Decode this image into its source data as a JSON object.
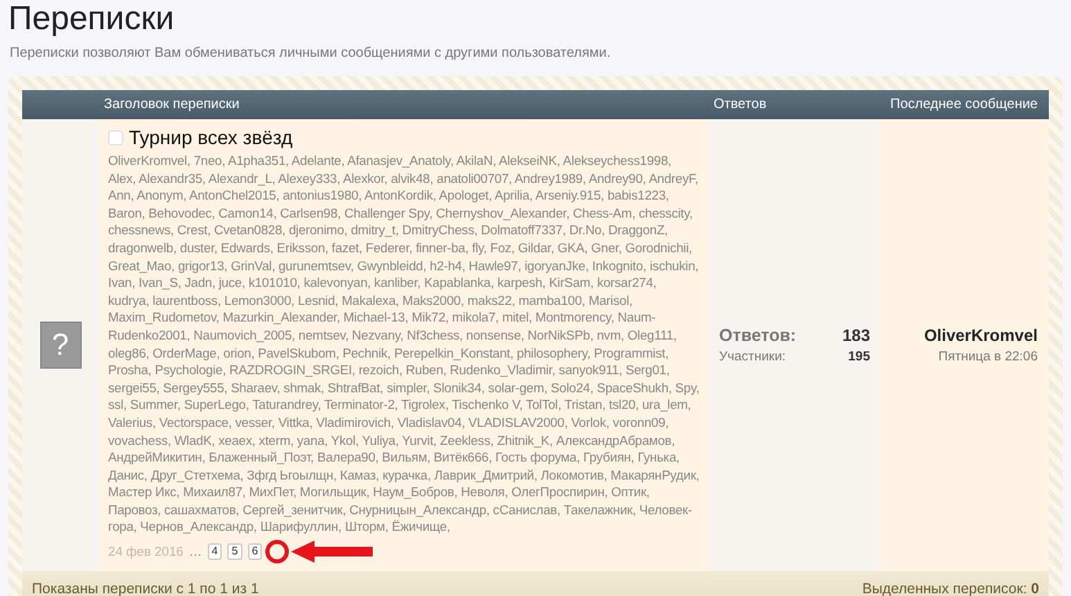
{
  "page": {
    "title": "Переписки",
    "description": "Переписки позволяют Вам обмениваться личными сообщениями с другими пользователями."
  },
  "table": {
    "columns": [
      "Заголовок переписки",
      "Ответов",
      "Последнее сообщение"
    ],
    "rows": [
      {
        "avatar_symbol": "?",
        "checked": false,
        "title": "Турнир всех звёзд",
        "participants": "OliverKromvel, 7neo, A1pha351, Adelante, Afanasjev_Anatoly, AkilaN, AlekseiNK, Alekseychess1998, Alex, Alexandr35, Alexandr_L, Alexey333, Alexkor, alvik48, anatoli00707, Andrey1989, Andrey90, AndreyF, Ann, Anonym, AntonChel2015, antonius1980, AntonKordik, Apologet, Aprilia, Arseniy.915, babis1223, Baron, Behovodec, Camon14, Carlsen98, Challenger Spy, Chernyshov_Alexander, Chess-Am, chesscity, chessnews, Crest, Cvetan0828, djeronimo, dmitry_t, DmitryChess, Dolmatoff7337, Dr.No, DraggonZ, dragonwelb, duster, Edwards, Eriksson, fazet, Federer, finner-ba, fly, Foz, Gildar, GKA, Gner, Gorodnichii, Great_Mao, grigor13, GrinVal, gurunemtsev, Gwynbleidd, h2-h4, Hawle97, igoryanJke, Inkognito, ischukin, Ivan, Ivan_S, Jadn, juce, k101010, kalevonyan, kanliber, Kapablanka, karpesh, KirSam, korsar274, kudrya, laurentboss, Lemon3000, Lesnid, Makalexa, Maks2000, maks22, mamba100, Marisol, Maxim_Rudometov, Mazurkin_Alexander, Michael-13, Mik72, mikola7, mitel, Montmorency, Naum-Rudenko2001, Naumovich_2005, nemtsev, Nezvany, Nf3chess, nonsense, NorNikSPb, nvm, Oleg111, oleg86, OrderMage, orion, PavelSkubom, Pechnik, Perepelkin_Konstant, philosophery, Programmist, Prosha, Psychologie, RAZDROGIN_SRGEI, rezoich, Ruben, Rudenko_Vladimir, sanyok911, Serg01, sergei55, Sergey555, Sharaev, shmak, ShtrafBat, simpler, Slonik34, solar-gem, Solo24, SpaceShukh, Spy, ssl, Summer, SuperLego, Taturandrey, Terminator-2, Tigrolex, Tischenko V, TolTol, Tristan, tsl20, ura_lem, Valerius, Vectorspace, vesser, Vittka, Vladimirovich, Vladislav04, VLADISLAV2000, Vorlok, voronn09, vovachess, WladK, xeaex, xterm, yana, Ykol, Yuliya, Yurvit, Zeekless, Zhitnik_K, АлександрАбрамов, АндрейМикитин, Блаженный_Поэт, Валера90, Вильям, Витёк666, Гость форума, Грубиян, Гунька, Данис, Друг_Стетхема, Зфгд Ьгоылщн, Камаз, курачка, Лаврик_Дмитрий, Локомотив, МакарянРудик, Мастер Икс, Михаил87, МихПет, Могильщик, Наум_Бобров, Неволя, ОлегПроспирин, Оптик, Паровоз, сашахматов, Сергей_зенитчик, Снурницын_Александр, сСанислав, Такелажник, Человек-гора, Чернов_Александр, Шарифуллин, Шторм, Ёжичище,",
        "date": "24 фев 2016",
        "ellipsis": "…",
        "pages": [
          "4",
          "5",
          "6"
        ],
        "replies_label": "Ответов:",
        "replies": "183",
        "participants_label": "Участники:",
        "participants_count": "195",
        "last_author": "OliverKromvel",
        "last_time": "Пятница в 22:06"
      }
    ]
  },
  "footer": {
    "shown": "Показаны переписки с 1 по 1 из 1",
    "selected_label": "Выделенных переписок:",
    "selected_count": "0"
  }
}
